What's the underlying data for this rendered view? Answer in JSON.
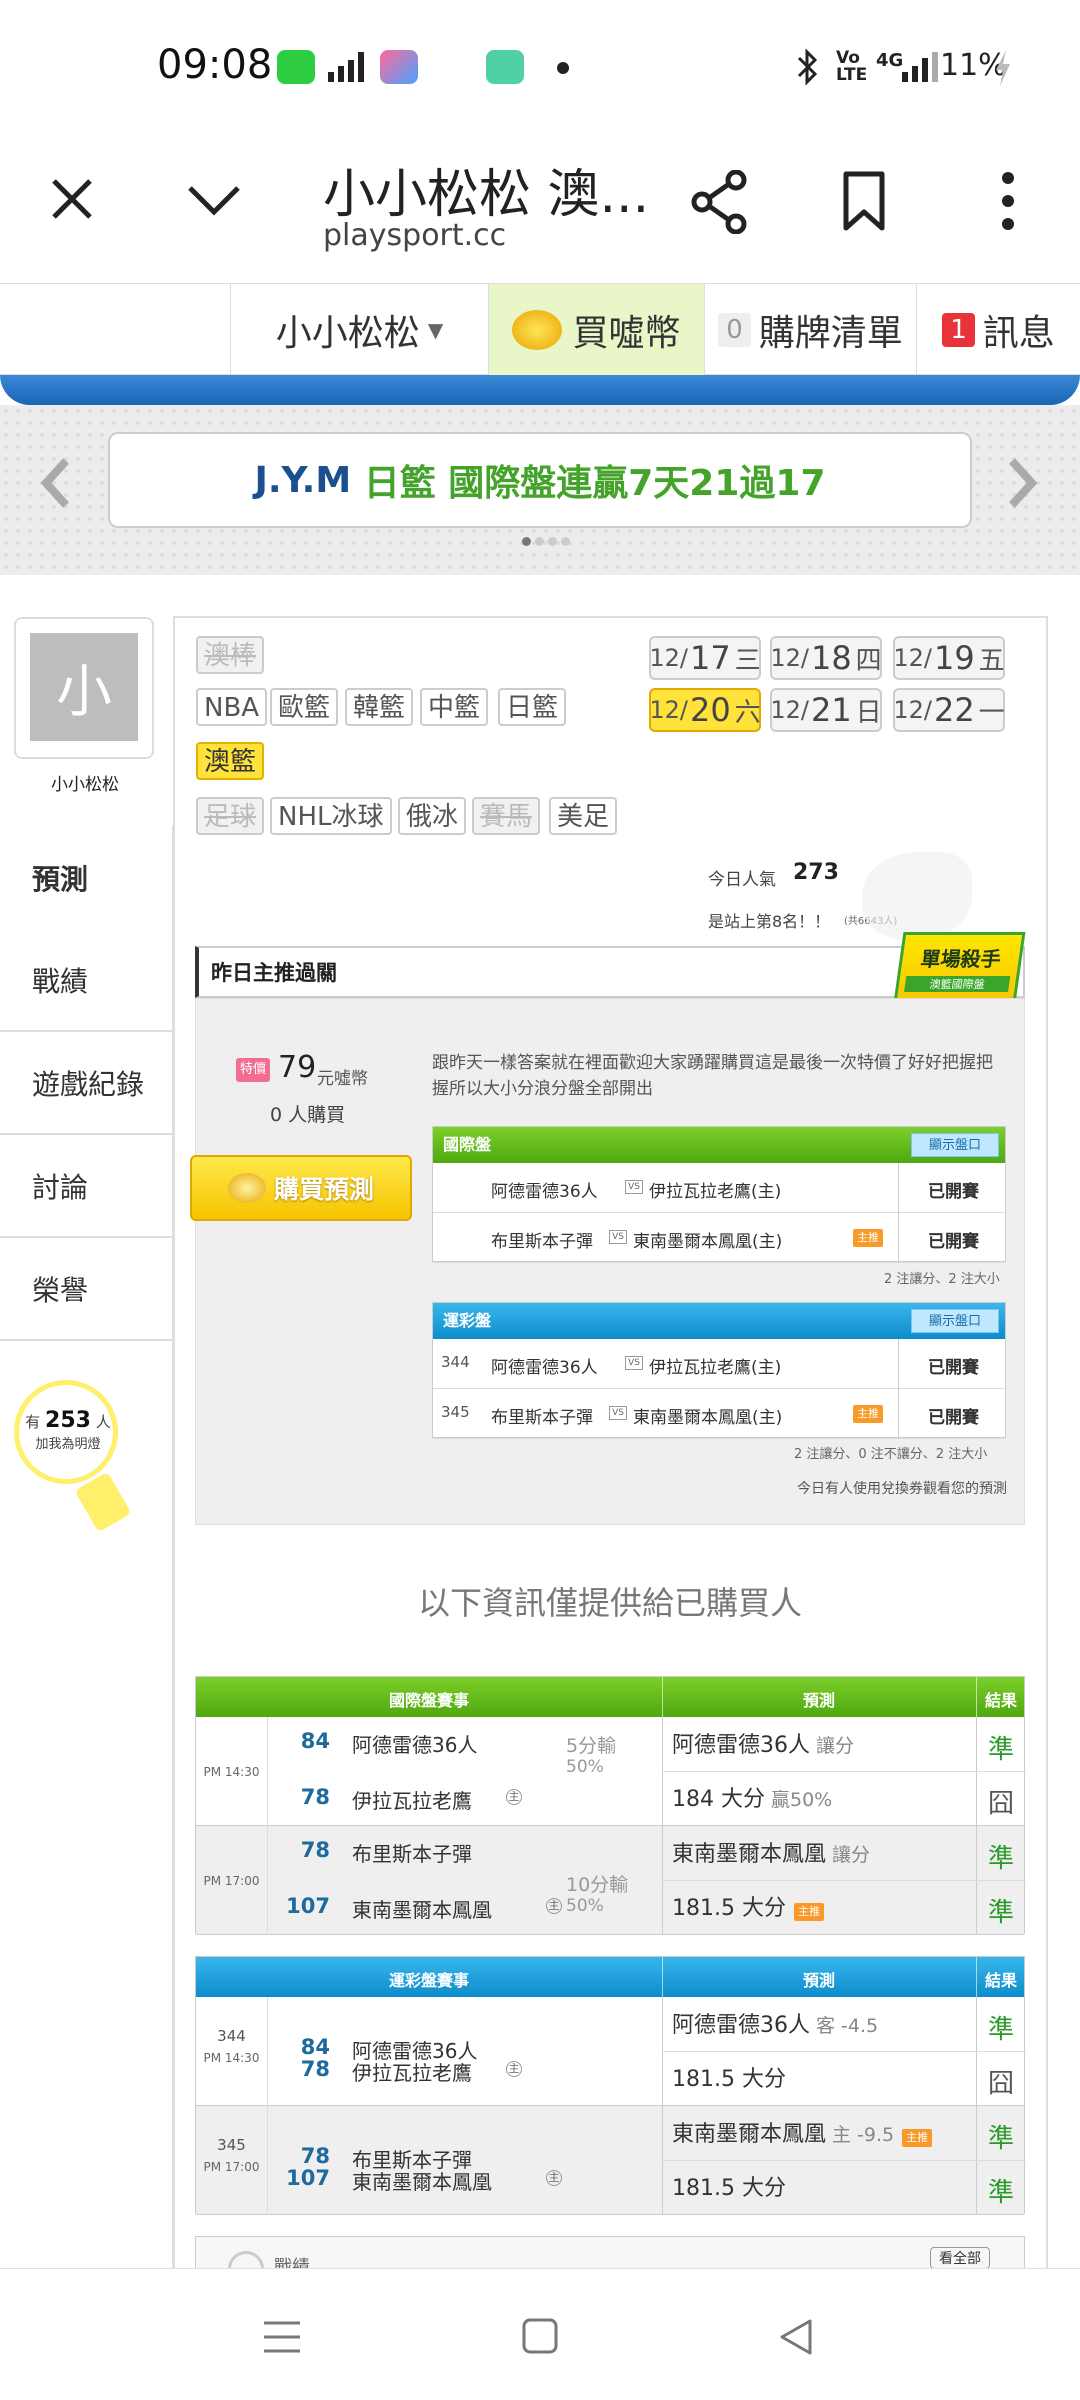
{
  "status_bar": {
    "time": "09:08",
    "network": "4G",
    "battery": "11%",
    "volte": "Vo LTE"
  },
  "browser": {
    "title": "小小松松 澳...",
    "url": "playsport.cc"
  },
  "site_nav": {
    "user": "小小松松",
    "buy_coins": "買噓幣",
    "cart_count": "0",
    "cart_label": "購牌清單",
    "msg_count": "1",
    "msg_label": "訊息"
  },
  "banner": {
    "part1": "J.Y.M",
    "part2": "日籃 國際盤連贏7天21過17"
  },
  "profile": {
    "avatar_char": "小",
    "name": "小小松松"
  },
  "sports": [
    "澳棒",
    "NBA",
    "歐籃",
    "韓籃",
    "中籃",
    "日籃",
    "澳籃",
    "足球",
    "NHL冰球",
    "俄冰",
    "賽馬",
    "美足"
  ],
  "dates": [
    {
      "md": "12/",
      "d": "17",
      "w": "三"
    },
    {
      "md": "12/",
      "d": "18",
      "w": "四"
    },
    {
      "md": "12/",
      "d": "19",
      "w": "五"
    },
    {
      "md": "12/",
      "d": "20",
      "w": "六"
    },
    {
      "md": "12/",
      "d": "21",
      "w": "日"
    },
    {
      "md": "12/",
      "d": "22",
      "w": "一"
    }
  ],
  "side_tabs": [
    "預測",
    "戰績",
    "遊戲紀錄",
    "討論",
    "榮譽"
  ],
  "bulb": {
    "pre": "有",
    "count": "253",
    "post": "人",
    "line2": "加我為明燈"
  },
  "popularity": {
    "label": "今日人氣",
    "value": "273",
    "rank": "是站上第8名！！",
    "total": "(共6643人)"
  },
  "badge": {
    "title": "單場殺手",
    "sub": "澳籃國際盤"
  },
  "section_title": "昨日主推過關",
  "price": {
    "tag": "特價",
    "amount": "79",
    "unit": "元噓幣",
    "buyers": "0 人購買",
    "buy_button": "購買預測"
  },
  "desc": "跟昨天一樣答案就在裡面歡迎大家踴躍購買這是最後一次特價了好好把握把握所以大小分浪分盤全部開出",
  "intl_box": {
    "header": "國際盤",
    "show": "顯示盤口",
    "rows": [
      {
        "away": "阿德雷德36人",
        "home": "伊拉瓦拉老鷹(主)",
        "status": "已開賽",
        "hometag": ""
      },
      {
        "away": "布里斯本子彈",
        "home": "東南墨爾本鳳凰(主)",
        "status": "已開賽",
        "hometag": "主推"
      }
    ],
    "summary": "2 注讓分、2 注大小"
  },
  "sport_box": {
    "header": "運彩盤",
    "show": "顯示盤口",
    "rows": [
      {
        "no": "344",
        "away": "阿德雷德36人",
        "home": "伊拉瓦拉老鷹(主)",
        "status": "已開賽",
        "hometag": ""
      },
      {
        "no": "345",
        "away": "布里斯本子彈",
        "home": "東南墨爾本鳳凰(主)",
        "status": "已開賽",
        "hometag": "主推"
      }
    ],
    "summary": "2 注讓分、0 注不讓分、2 注大小",
    "note": "今日有人使用兌換券觀看您的預測"
  },
  "notice": "以下資訊僅提供給已購買人",
  "table1": {
    "h1": "國際盤賽事",
    "h2": "預測",
    "h3": "結果",
    "games": [
      {
        "time": "PM 14:30",
        "s1": "84",
        "t1": "阿德雷德36人",
        "s2": "78",
        "t2": "伊拉瓦拉老鷹",
        "hm": "主",
        "line": "5分輸",
        "pct": "50%",
        "p1": "阿德雷德36人",
        "p1x": "讓分",
        "r1": "準",
        "p2": "184 大分",
        "p2x": "贏50%",
        "r2": "囧"
      },
      {
        "time": "PM 17:00",
        "s1": "78",
        "t1": "布里斯本子彈",
        "s2": "107",
        "t2": "東南墨爾本鳳凰",
        "hm": "主",
        "line": "10分輸",
        "pct": "50%",
        "p1": "東南墨爾本鳳凰",
        "p1x": "讓分",
        "r1": "準",
        "p2": "181.5 大分",
        "p2x": "主推",
        "r2": "準"
      }
    ]
  },
  "table2": {
    "h1": "運彩盤賽事",
    "h2": "預測",
    "h3": "結果",
    "games": [
      {
        "no": "344",
        "time": "PM 14:30",
        "s1": "84",
        "t1": "阿德雷德36人",
        "s2": "78",
        "t2": "伊拉瓦拉老鷹",
        "hm": "主",
        "p1": "阿德雷德36人",
        "p1x": "客 -4.5",
        "r1": "準",
        "p2": "181.5 大分",
        "r2": "囧"
      },
      {
        "no": "345",
        "time": "PM 17:00",
        "s1": "78",
        "t1": "布里斯本子彈",
        "s2": "107",
        "t2": "東南墨爾本鳳凰",
        "hm": "主",
        "p1": "東南墨爾本鳳凰",
        "p1x": "主 -9.5",
        "p1tag": "主推",
        "r1": "準",
        "p2": "181.5 大分",
        "r2": "準"
      }
    ]
  },
  "bottom_peek": {
    "left": "戰績",
    "right": "看全部"
  },
  "colors": {
    "green": "#5cb21a",
    "blue": "#1a96d6",
    "yellow": "#ffe23a",
    "title_blue": "#1c63b5"
  }
}
